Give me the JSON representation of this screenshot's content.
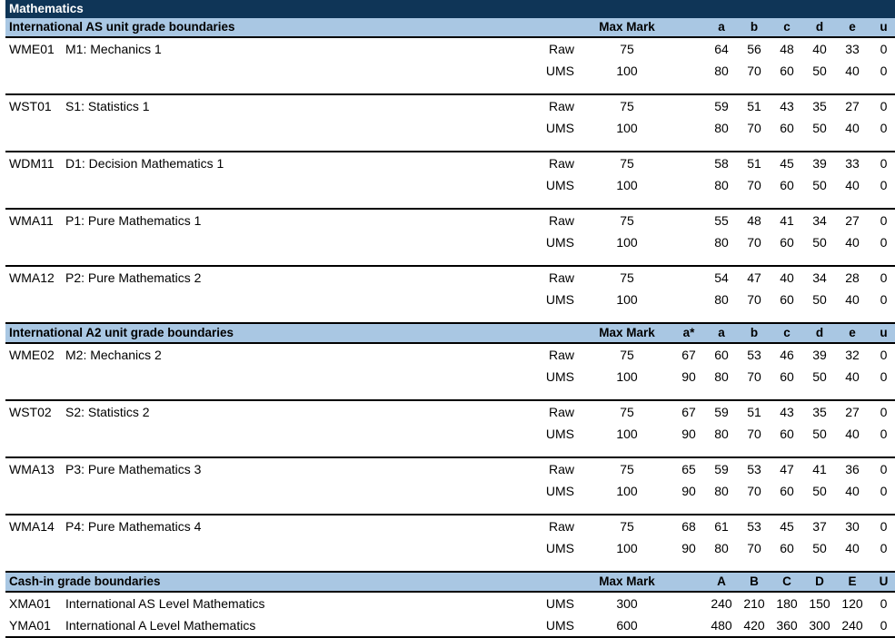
{
  "document": {
    "title": "Mathematics"
  },
  "sections": [
    {
      "id": "international-as-unit",
      "heading": "International AS unit grade boundaries",
      "max_mark_header": "Max Mark",
      "grade_headers": [
        "a",
        "b",
        "c",
        "d",
        "e",
        "u"
      ],
      "has_astar": false,
      "rows": [
        {
          "code": "WME01",
          "name": "M1: Mechanics 1",
          "lines": [
            {
              "type": "Raw",
              "max": "75",
              "grades": [
                "64",
                "56",
                "48",
                "40",
                "33",
                "0"
              ]
            },
            {
              "type": "UMS",
              "max": "100",
              "grades": [
                "80",
                "70",
                "60",
                "50",
                "40",
                "0"
              ]
            }
          ]
        },
        {
          "code": "WST01",
          "name": "S1: Statistics 1",
          "lines": [
            {
              "type": "Raw",
              "max": "75",
              "grades": [
                "59",
                "51",
                "43",
                "35",
                "27",
                "0"
              ]
            },
            {
              "type": "UMS",
              "max": "100",
              "grades": [
                "80",
                "70",
                "60",
                "50",
                "40",
                "0"
              ]
            }
          ]
        },
        {
          "code": "WDM11",
          "name": "D1: Decision Mathematics 1",
          "lines": [
            {
              "type": "Raw",
              "max": "75",
              "grades": [
                "58",
                "51",
                "45",
                "39",
                "33",
                "0"
              ]
            },
            {
              "type": "UMS",
              "max": "100",
              "grades": [
                "80",
                "70",
                "60",
                "50",
                "40",
                "0"
              ]
            }
          ]
        },
        {
          "code": "WMA11",
          "name": "P1: Pure Mathematics 1",
          "lines": [
            {
              "type": "Raw",
              "max": "75",
              "grades": [
                "55",
                "48",
                "41",
                "34",
                "27",
                "0"
              ]
            },
            {
              "type": "UMS",
              "max": "100",
              "grades": [
                "80",
                "70",
                "60",
                "50",
                "40",
                "0"
              ]
            }
          ]
        },
        {
          "code": "WMA12",
          "name": "P2: Pure Mathematics 2",
          "lines": [
            {
              "type": "Raw",
              "max": "75",
              "grades": [
                "54",
                "47",
                "40",
                "34",
                "28",
                "0"
              ]
            },
            {
              "type": "UMS",
              "max": "100",
              "grades": [
                "80",
                "70",
                "60",
                "50",
                "40",
                "0"
              ]
            }
          ]
        }
      ]
    },
    {
      "id": "international-a2-unit",
      "heading": "International A2 unit grade boundaries",
      "max_mark_header": "Max Mark",
      "grade_headers": [
        "a*",
        "a",
        "b",
        "c",
        "d",
        "e",
        "u"
      ],
      "has_astar": true,
      "rows": [
        {
          "code": "WME02",
          "name": "M2: Mechanics 2",
          "lines": [
            {
              "type": "Raw",
              "max": "75",
              "grades": [
                "67",
                "60",
                "53",
                "46",
                "39",
                "32",
                "0"
              ]
            },
            {
              "type": "UMS",
              "max": "100",
              "grades": [
                "90",
                "80",
                "70",
                "60",
                "50",
                "40",
                "0"
              ]
            }
          ]
        },
        {
          "code": "WST02",
          "name": "S2: Statistics 2",
          "lines": [
            {
              "type": "Raw",
              "max": "75",
              "grades": [
                "67",
                "59",
                "51",
                "43",
                "35",
                "27",
                "0"
              ]
            },
            {
              "type": "UMS",
              "max": "100",
              "grades": [
                "90",
                "80",
                "70",
                "60",
                "50",
                "40",
                "0"
              ]
            }
          ]
        },
        {
          "code": "WMA13",
          "name": "P3: Pure Mathematics 3",
          "lines": [
            {
              "type": "Raw",
              "max": "75",
              "grades": [
                "65",
                "59",
                "53",
                "47",
                "41",
                "36",
                "0"
              ]
            },
            {
              "type": "UMS",
              "max": "100",
              "grades": [
                "90",
                "80",
                "70",
                "60",
                "50",
                "40",
                "0"
              ]
            }
          ]
        },
        {
          "code": "WMA14",
          "name": "P4: Pure Mathematics 4",
          "lines": [
            {
              "type": "Raw",
              "max": "75",
              "grades": [
                "68",
                "61",
                "53",
                "45",
                "37",
                "30",
                "0"
              ]
            },
            {
              "type": "UMS",
              "max": "100",
              "grades": [
                "90",
                "80",
                "70",
                "60",
                "50",
                "40",
                "0"
              ]
            }
          ]
        }
      ]
    },
    {
      "id": "cash-in",
      "heading": "Cash-in grade boundaries",
      "max_mark_header": "Max Mark",
      "grade_headers": [
        "A",
        "B",
        "C",
        "D",
        "E",
        "U"
      ],
      "has_astar": false,
      "rows": [
        {
          "code": "XMA01",
          "name": "International AS Level Mathematics",
          "lines": [
            {
              "type": "UMS",
              "max": "300",
              "grades": [
                "240",
                "210",
                "180",
                "150",
                "120",
                "0"
              ]
            }
          ]
        },
        {
          "code": "YMA01",
          "name": "International A Level Mathematics",
          "lines": [
            {
              "type": "UMS",
              "max": "600",
              "grades": [
                "480",
                "420",
                "360",
                "300",
                "240",
                "0"
              ]
            }
          ]
        }
      ]
    }
  ],
  "colors": {
    "title_bar": "#0f3557",
    "section_bar": "#a9c7e3",
    "rule": "#000000",
    "page": "#ffffff"
  }
}
